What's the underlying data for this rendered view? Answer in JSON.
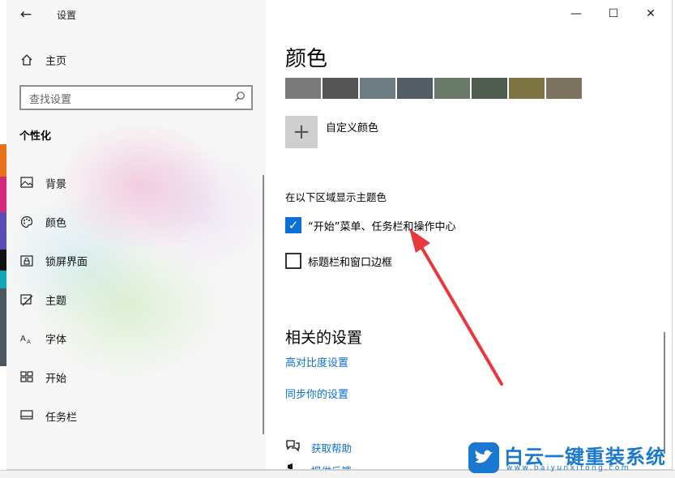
{
  "window": {
    "title": "设置",
    "back_icon": "arrow-left-icon",
    "controls": {
      "minimize": "—",
      "maximize": "☐",
      "close": "✕"
    }
  },
  "sidebar": {
    "home_label": "主页",
    "search_placeholder": "查找设置",
    "section_title": "个性化",
    "items": [
      {
        "label": "背景",
        "icon": "picture-icon"
      },
      {
        "label": "颜色",
        "icon": "palette-icon"
      },
      {
        "label": "锁屏界面",
        "icon": "lock-screen-icon"
      },
      {
        "label": "主题",
        "icon": "theme-icon"
      },
      {
        "label": "字体",
        "icon": "font-icon"
      },
      {
        "label": "开始",
        "icon": "start-icon"
      },
      {
        "label": "任务栏",
        "icon": "taskbar-icon"
      }
    ]
  },
  "main": {
    "title": "颜色",
    "swatches": [
      "#7a7a7a",
      "#545454",
      "#6d7c83",
      "#515c63",
      "#69796a",
      "#4f5b4f",
      "#7c7442",
      "#7c735f"
    ],
    "custom_color_label": "自定义颜色",
    "accent_section_title": "在以下区域显示主题色",
    "checkbox_start": {
      "label": "“开始”菜单、任务栏和操作中心",
      "checked": true
    },
    "checkbox_titlebar": {
      "label": "标题栏和窗口边框",
      "checked": false
    },
    "related_title": "相关的设置",
    "links": [
      "高对比度设置",
      "同步你的设置"
    ],
    "help": {
      "get_help": "获取帮助",
      "feedback": "提供反馈"
    }
  },
  "watermark": {
    "text": "白云一键重装系统",
    "url": "www.baiyunxitong.com"
  },
  "colors": {
    "accent": "#0a6fd6",
    "annotation_arrow": "#e8383d"
  }
}
